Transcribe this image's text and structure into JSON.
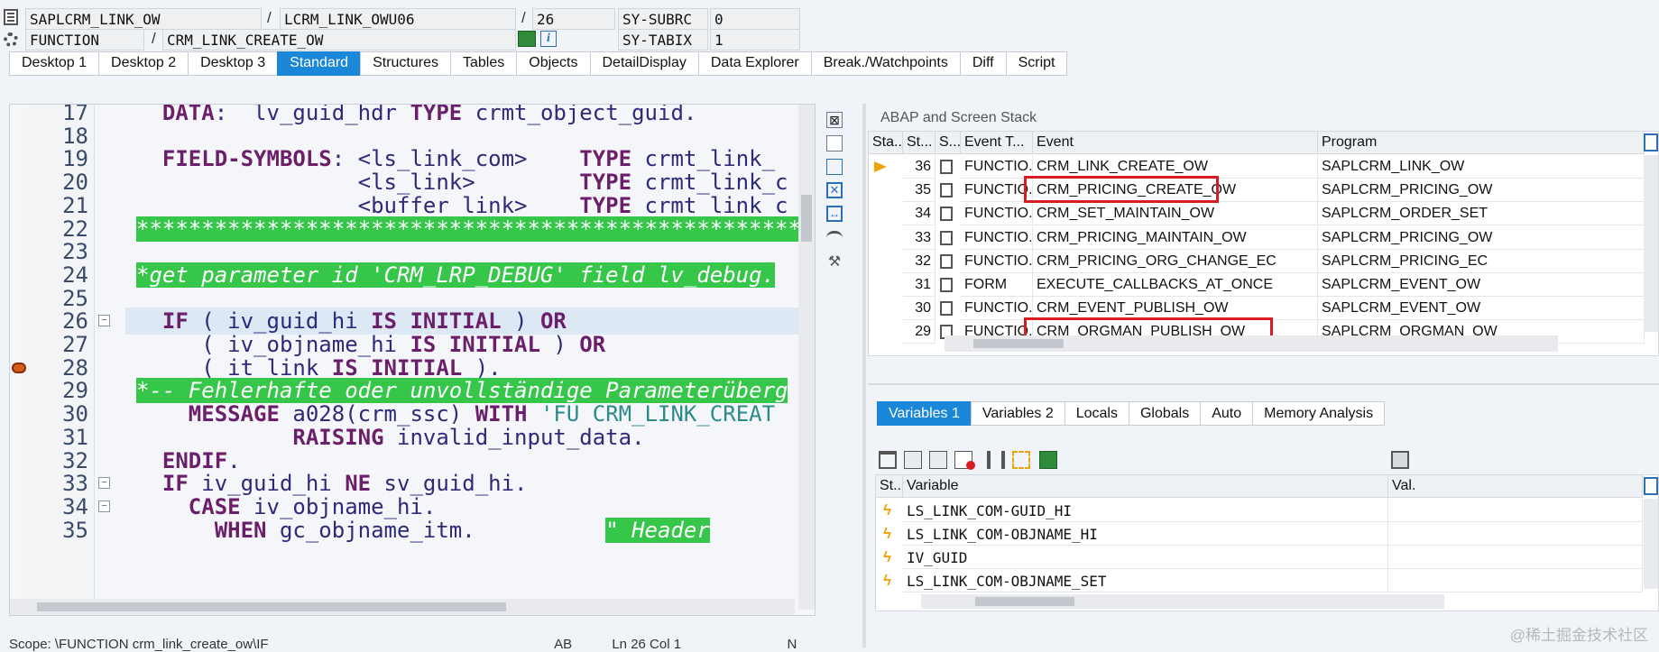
{
  "header": {
    "program": "SAPLCRM_LINK_OW",
    "include": "LCRM_LINK_OWU06",
    "line": "26",
    "subrc_label": "SY-SUBRC",
    "subrc_value": "0",
    "type": "FUNCTION",
    "name": "CRM_LINK_CREATE_OW",
    "tabix_label": "SY-TABIX",
    "tabix_value": "1",
    "separator": "/"
  },
  "tabs": [
    "Desktop 1",
    "Desktop 2",
    "Desktop 3",
    "Standard",
    "Structures",
    "Tables",
    "Objects",
    "DetailDisplay",
    "Data Explorer",
    "Break./Watchpoints",
    "Diff",
    "Script"
  ],
  "active_tab": "Standard",
  "code": {
    "lines": [
      {
        "no": "17",
        "parts": [
          [
            "  ",
            ""
          ],
          [
            "DATA",
            "kw"
          ],
          [
            ":  lv_guid_hdr ",
            ""
          ],
          [
            "TYPE",
            "kw"
          ],
          [
            " crmt_object_guid.",
            ""
          ]
        ]
      },
      {
        "no": "18",
        "parts": []
      },
      {
        "no": "19",
        "parts": [
          [
            "  ",
            ""
          ],
          [
            "FIELD-SYMBOLS",
            "kw"
          ],
          [
            ": <ls_link_com>    ",
            ""
          ],
          [
            "TYPE",
            "kw"
          ],
          [
            " crmt_link_",
            ""
          ]
        ]
      },
      {
        "no": "20",
        "parts": [
          [
            "                 <ls_link>        ",
            ""
          ],
          [
            "TYPE",
            "kw"
          ],
          [
            " crmt_link_c",
            ""
          ]
        ]
      },
      {
        "no": "21",
        "parts": [
          [
            "                 <buffer_link>    ",
            ""
          ],
          [
            "TYPE",
            "kw"
          ],
          [
            " crmt_link_c",
            ""
          ]
        ]
      },
      {
        "no": "22",
        "parts": [
          [
            "**********************************************************",
            "green"
          ]
        ]
      },
      {
        "no": "23",
        "parts": []
      },
      {
        "no": "24",
        "parts": [
          [
            "*get parameter id 'CRM_LRP_DEBUG' field lv_debug.",
            "green"
          ]
        ]
      },
      {
        "no": "25",
        "parts": []
      },
      {
        "no": "26",
        "parts": [
          [
            "  ",
            ""
          ],
          [
            "IF",
            "kw"
          ],
          [
            " ( iv_guid_hi ",
            ""
          ],
          [
            "IS INITIAL",
            "kw"
          ],
          [
            " ) ",
            ""
          ],
          [
            "OR",
            "kw"
          ]
        ]
      },
      {
        "no": "27",
        "parts": [
          [
            "     ( iv_objname_hi ",
            ""
          ],
          [
            "IS INITIAL",
            "kw"
          ],
          [
            " ) ",
            ""
          ],
          [
            "OR",
            "kw"
          ]
        ]
      },
      {
        "no": "28",
        "parts": [
          [
            "     ( it_link ",
            ""
          ],
          [
            "IS INITIAL",
            "kw"
          ],
          [
            " ).",
            ""
          ]
        ]
      },
      {
        "no": "29",
        "parts": [
          [
            "*-- Fehlerhafte oder unvollständige Parameterüberg",
            "green"
          ]
        ]
      },
      {
        "no": "30",
        "parts": [
          [
            "    ",
            ""
          ],
          [
            "MESSAGE",
            "kw"
          ],
          [
            " a028(crm_ssc) ",
            ""
          ],
          [
            "WITH",
            "kw"
          ],
          [
            " ",
            ""
          ],
          [
            "'FU CRM_LINK_CREAT",
            "str"
          ]
        ]
      },
      {
        "no": "31",
        "parts": [
          [
            "            ",
            ""
          ],
          [
            "RAISING",
            "kw"
          ],
          [
            " invalid_input_data.",
            ""
          ]
        ]
      },
      {
        "no": "32",
        "parts": [
          [
            "  ",
            ""
          ],
          [
            "ENDIF",
            "kw"
          ],
          [
            ".",
            ""
          ]
        ]
      },
      {
        "no": "33",
        "parts": [
          [
            "  ",
            ""
          ],
          [
            "IF",
            "kw"
          ],
          [
            " iv_guid_hi ",
            ""
          ],
          [
            "NE",
            "kw"
          ],
          [
            " sv_guid_hi.",
            ""
          ]
        ]
      },
      {
        "no": "34",
        "parts": [
          [
            "    ",
            ""
          ],
          [
            "CASE",
            "kw"
          ],
          [
            " iv_objname_hi.",
            ""
          ]
        ]
      },
      {
        "no": "35",
        "parts": [
          [
            "      ",
            ""
          ],
          [
            "WHEN",
            "kw"
          ],
          [
            " gc_objname_itm.",
            ""
          ],
          [
            "          ",
            ""
          ],
          [
            "\" Header",
            "green"
          ]
        ]
      }
    ]
  },
  "stack": {
    "title": "ABAP and Screen Stack",
    "columns": [
      "Sta...",
      "St...",
      "S...",
      "Event T...",
      "Event",
      "Program"
    ],
    "rows": [
      {
        "level": "36",
        "type": "FUNCTIO...",
        "event": "CRM_LINK_CREATE_OW",
        "program": "SAPLCRM_LINK_OW",
        "current": true
      },
      {
        "level": "35",
        "type": "FUNCTIO...",
        "event": "CRM_PRICING_CREATE_OW",
        "program": "SAPLCRM_PRICING_OW"
      },
      {
        "level": "34",
        "type": "FUNCTIO...",
        "event": "CRM_SET_MAINTAIN_OW",
        "program": "SAPLCRM_ORDER_SET"
      },
      {
        "level": "33",
        "type": "FUNCTIO...",
        "event": "CRM_PRICING_MAINTAIN_OW",
        "program": "SAPLCRM_PRICING_OW"
      },
      {
        "level": "32",
        "type": "FUNCTIO...",
        "event": "CRM_PRICING_ORG_CHANGE_EC",
        "program": "SAPLCRM_PRICING_EC"
      },
      {
        "level": "31",
        "type": "FORM",
        "event": "EXECUTE_CALLBACKS_AT_ONCE",
        "program": "SAPLCRM_EVENT_OW"
      },
      {
        "level": "30",
        "type": "FUNCTIO...",
        "event": "CRM_EVENT_PUBLISH_OW",
        "program": "SAPLCRM_EVENT_OW"
      },
      {
        "level": "29",
        "type": "FUNCTIO...",
        "event": "CRM_ORGMAN_PUBLISH_OW",
        "program": "SAPLCRM_ORGMAN_OW"
      }
    ]
  },
  "variables": {
    "tabs": [
      "Variables 1",
      "Variables 2",
      "Locals",
      "Globals",
      "Auto",
      "Memory Analysis"
    ],
    "active_tab": "Variables 1",
    "columns": [
      "St...",
      "Variable",
      "Val."
    ],
    "rows": [
      "LS_LINK_COM-GUID_HI",
      "LS_LINK_COM-OBJNAME_HI",
      "IV_GUID",
      "LS_LINK_COM-OBJNAME_SET"
    ]
  },
  "statusbar": {
    "scope": "Scope: \\FUNCTION crm_link_create_ow\\IF",
    "mode": "AB",
    "position": "Ln  26 Col   1",
    "ins": "N"
  },
  "watermark": "@稀土掘金技术社区",
  "colors": {
    "accent": "#1b87d8",
    "comment": "#35c64a",
    "keyword": "#6b1f6b",
    "highlight_box": "#d81c22"
  }
}
